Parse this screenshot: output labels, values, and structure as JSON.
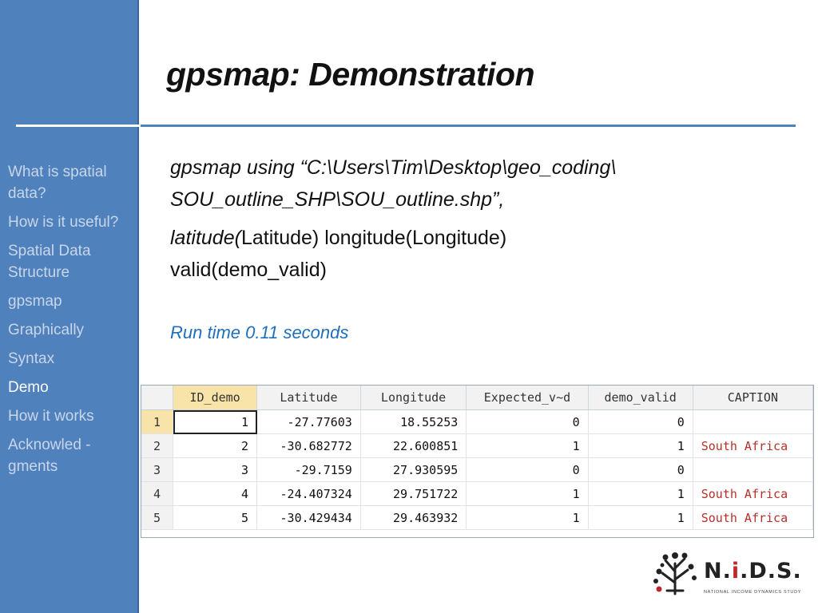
{
  "sidebar": {
    "items": [
      {
        "label": "What is spatial data?",
        "active": false
      },
      {
        "label": "How is it useful?",
        "active": false
      },
      {
        "label": "Spatial Data Structure",
        "active": false
      },
      {
        "label": "gpsmap",
        "active": false
      },
      {
        "label": "Graphically",
        "active": false
      },
      {
        "label": "Syntax",
        "active": false
      },
      {
        "label": "Demo",
        "active": true
      },
      {
        "label": "How it works",
        "active": false
      },
      {
        "label": "Acknowled - gments",
        "active": false
      }
    ]
  },
  "slide": {
    "title": "gpsmap: Demonstration",
    "command_line1": "gpsmap using  “C:\\Users\\Tim\\Desktop\\geo_coding\\",
    "command_line2": "SOU_outline_SHP\\SOU_outline.shp”,",
    "command_line3_italic": "latitude(",
    "command_line3_rest": "Latitude) longitude(Longitude)",
    "command_line4": "valid(demo_valid)",
    "run_time": "Run time 0.11 seconds"
  },
  "grid": {
    "columns": [
      "ID_demo",
      "Latitude",
      "Longitude",
      "Expected_v~d",
      "demo_valid",
      "CAPTION"
    ],
    "rows": [
      {
        "n": "1",
        "cells": [
          "1",
          "-27.77603",
          "18.55253",
          "0",
          "0",
          ""
        ]
      },
      {
        "n": "2",
        "cells": [
          "2",
          "-30.682772",
          "22.600851",
          "1",
          "1",
          "South Africa"
        ]
      },
      {
        "n": "3",
        "cells": [
          "3",
          "-29.7159",
          "27.930595",
          "0",
          "0",
          ""
        ]
      },
      {
        "n": "4",
        "cells": [
          "4",
          "-24.407324",
          "29.751722",
          "1",
          "1",
          "South Africa"
        ]
      },
      {
        "n": "5",
        "cells": [
          "5",
          "-30.429434",
          "29.463932",
          "1",
          "1",
          "South Africa"
        ]
      }
    ],
    "selected_row": "1"
  },
  "logo": {
    "icon": "tree-icon",
    "text_before": "N.",
    "text_red": "i",
    "text_after": ".D.S.",
    "subtitle": "NATIONAL INCOME DYNAMICS STUDY"
  },
  "colors": {
    "sidebar": "#4f81bd",
    "accent": "#1f6fbf",
    "caption_text": "#b5312a",
    "logo_red": "#c0262d"
  }
}
